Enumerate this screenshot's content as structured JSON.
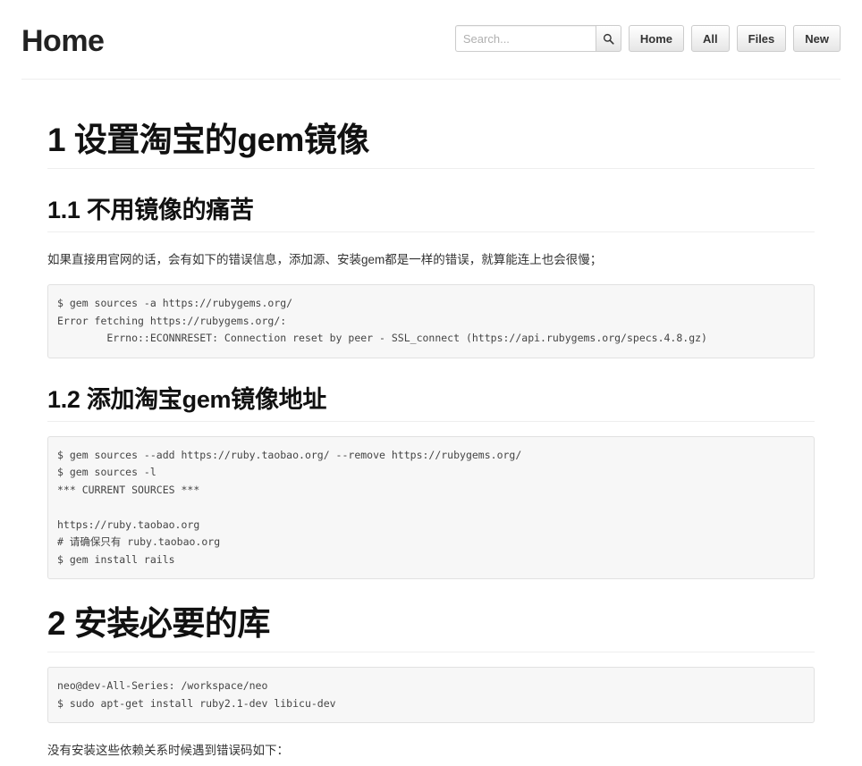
{
  "header": {
    "title": "Home",
    "search": {
      "placeholder": "Search...",
      "value": "",
      "button_icon": "search-icon"
    },
    "nav_buttons": [
      {
        "label": "Home"
      },
      {
        "label": "All"
      },
      {
        "label": "Files"
      },
      {
        "label": "New"
      }
    ]
  },
  "content": {
    "blocks": [
      {
        "type": "h1",
        "name": "section-heading-1",
        "text": "1 设置淘宝的gem镜像"
      },
      {
        "type": "h2",
        "name": "section-heading-1-1",
        "text": "1.1 不用镜像的痛苦"
      },
      {
        "type": "p",
        "name": "paragraph-official-source-pain",
        "text": "如果直接用官网的话，会有如下的错误信息，添加源、安装gem都是一样的错误，就算能连上也会很慢；"
      },
      {
        "type": "code",
        "name": "code-block-gem-sources-error",
        "text": "$ gem sources -a https://rubygems.org/\nError fetching https://rubygems.org/:\n        Errno::ECONNRESET: Connection reset by peer - SSL_connect (https://api.rubygems.org/specs.4.8.gz)"
      },
      {
        "type": "h2",
        "name": "section-heading-1-2",
        "text": "1.2 添加淘宝gem镜像地址"
      },
      {
        "type": "code",
        "name": "code-block-add-taobao-source",
        "text": "$ gem sources --add https://ruby.taobao.org/ --remove https://rubygems.org/\n$ gem sources -l\n*** CURRENT SOURCES ***\n\nhttps://ruby.taobao.org\n# 请确保只有 ruby.taobao.org\n$ gem install rails"
      },
      {
        "type": "h1",
        "name": "section-heading-2",
        "text": "2 安装必要的库"
      },
      {
        "type": "code",
        "name": "code-block-apt-get-install",
        "text": "neo@dev-All-Series: /workspace/neo\n$ sudo apt-get install ruby2.1-dev libicu-dev"
      },
      {
        "type": "p",
        "name": "paragraph-missing-dependency-note",
        "text": "没有安装这些依赖关系时候遇到错误码如下："
      }
    ]
  },
  "colors": {
    "text": "#333333",
    "heading": "#111111",
    "rule": "#eeeeee",
    "code_background": "#f7f7f7",
    "code_border": "#e1e1e1",
    "button_border": "#cccccc"
  }
}
